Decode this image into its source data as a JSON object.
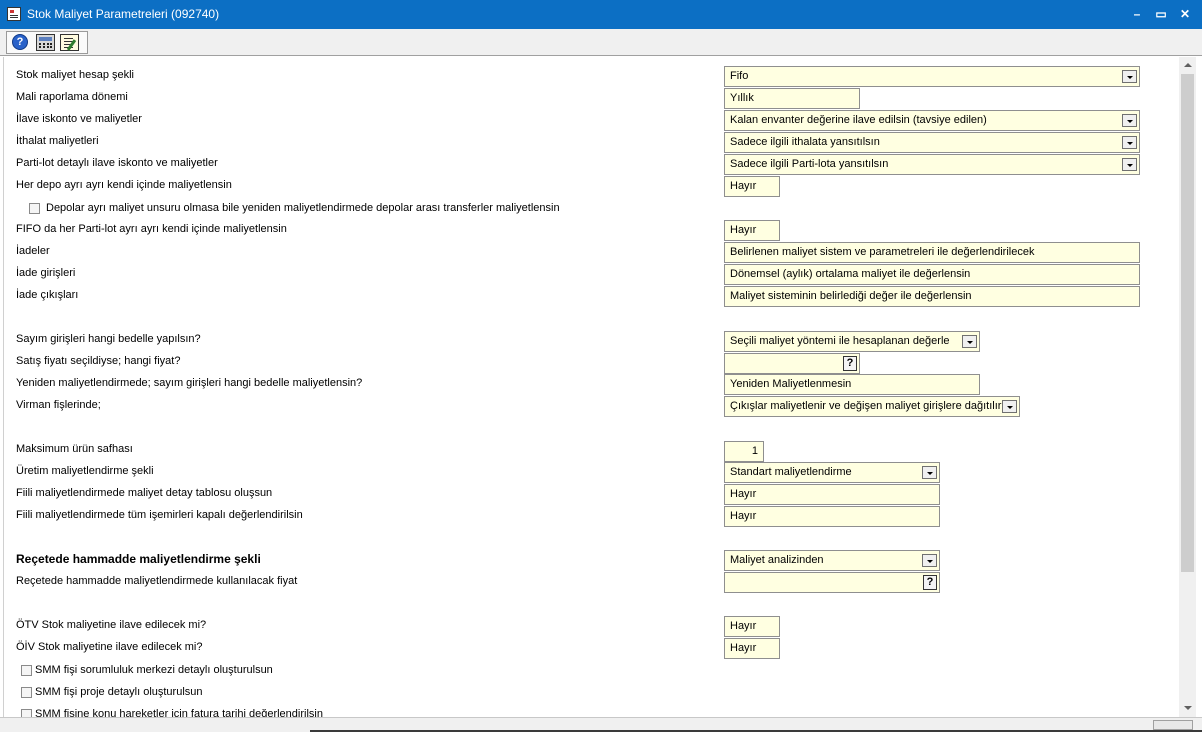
{
  "window": {
    "title": "Stok Maliyet Parametreleri (092740)",
    "controls": [
      "–",
      "▭",
      "✕"
    ]
  },
  "toolbar": {
    "help_glyph": "?",
    "buttons": [
      "help-icon",
      "calculator-icon",
      "notepad-icon"
    ]
  },
  "fields": {
    "stok_maliyet_hesap_sekli": {
      "label": "Stok maliyet hesap şekli",
      "value": "Fifo"
    },
    "mali_raporlama_donemi": {
      "label": "Mali raporlama dönemi",
      "value": "Yıllık"
    },
    "ilave_iskonto": {
      "label": "İlave iskonto ve maliyetler",
      "value": "Kalan envanter değerine ilave edilsin (tavsiye edilen)"
    },
    "ithalat_maliyetleri": {
      "label": "İthalat maliyetleri",
      "value": "Sadece ilgili ithalata yansıtılsın"
    },
    "parti_lot": {
      "label": "Parti-lot detaylı ilave iskonto ve maliyetler",
      "value": "Sadece ilgili Parti-lota yansıtılsın"
    },
    "her_depo": {
      "label": "Her depo ayrı ayrı kendi içinde maliyetlensin",
      "value": "Hayır"
    },
    "depolar_checkbox": {
      "label": "Depolar ayrı maliyet unsuru olmasa bile yeniden maliyetlendirmede depolar arası transferler maliyetlensin"
    },
    "fifo_parti_lot": {
      "label": "FIFO da her Parti-lot ayrı ayrı kendi içinde maliyetlensin",
      "value": "Hayır"
    },
    "iadeler": {
      "label": "İadeler",
      "value": "Belirlenen maliyet sistem ve parametreleri ile değerlendirilecek"
    },
    "iade_girisleri": {
      "label": "İade girişleri",
      "value": "Dönemsel (aylık) ortalama maliyet ile değerlensin"
    },
    "iade_cikislari": {
      "label": "İade çıkışları",
      "value": "Maliyet sisteminin belirlediği değer ile değerlensin"
    },
    "sayim_girisleri": {
      "label": "Sayım girişleri hangi bedelle yapılsın?",
      "value": "Seçili maliyet yöntemi ile hesaplanan değerle"
    },
    "satis_fiyati": {
      "label": "Satış fiyatı seçildiyse; hangi fiyat?",
      "value": ""
    },
    "yeniden_maliyet": {
      "label": "Yeniden maliyetlendirmede; sayım girişleri hangi bedelle maliyetlensin?",
      "value": "Yeniden Maliyetlenmesin"
    },
    "virman": {
      "label": "Virman fişlerinde;",
      "value": "Çıkışlar maliyetlenir ve değişen maliyet girişlere dağıtılır"
    },
    "maksimum_urun": {
      "label": "Maksimum ürün safhası",
      "value": "1"
    },
    "uretim_maliyet": {
      "label": "Üretim maliyetlendirme şekli",
      "value": "Standart maliyetlendirme"
    },
    "fiili_detay": {
      "label": "Fiili maliyetlendirmede maliyet detay tablosu oluşsun",
      "value": "Hayır"
    },
    "fiili_isemirleri": {
      "label": "Fiili maliyetlendirmede tüm işemirleri kapalı değerlendirilsin",
      "value": "Hayır"
    },
    "recete_hammadde": {
      "label": "Reçetede hammadde maliyetlendirme şekli",
      "value": "Maliyet analizinden"
    },
    "recete_fiyat": {
      "label": "Reçetede hammadde maliyetlendirmede kullanılacak fiyat",
      "value": ""
    },
    "otv": {
      "label": "ÖTV Stok maliyetine ilave edilecek mi?",
      "value": "Hayır"
    },
    "oiv": {
      "label": "ÖİV Stok maliyetine ilave edilecek mi?",
      "value": "Hayır"
    },
    "smm_sorumluluk": {
      "label": "SMM fişi sorumluluk merkezi detaylı oluşturulsun"
    },
    "smm_proje": {
      "label": "SMM fişi proje detaylı oluşturulsun"
    },
    "smm_fatura": {
      "label": "SMM fişine konu hareketler için fatura tarihi değerlendirilsin"
    }
  },
  "lookup_glyph": "?",
  "colors": {
    "titlebar": "#0c6fc4",
    "field_bg": "#ffffe1",
    "window_bg": "#ffffff"
  }
}
